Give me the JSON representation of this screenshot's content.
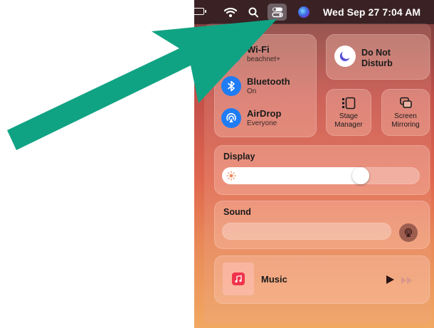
{
  "menubar": {
    "clock": "Wed Sep 27  7:04 AM",
    "icons": [
      "battery-icon",
      "wifi-icon",
      "search-icon",
      "control-center-icon",
      "siri-icon"
    ]
  },
  "control_center": {
    "network": {
      "wifi": {
        "title": "Wi-Fi",
        "subtitle": "beachnet+",
        "icon": "wifi-icon"
      },
      "bluetooth": {
        "title": "Bluetooth",
        "subtitle": "On",
        "icon": "bluetooth-icon"
      },
      "airdrop": {
        "title": "AirDrop",
        "subtitle": "Everyone",
        "icon": "airdrop-icon"
      }
    },
    "dnd": {
      "label": "Do Not Disturb",
      "icon": "moon-icon"
    },
    "stage_manager": {
      "label": "Stage Manager",
      "icon": "stage-manager-icon"
    },
    "screen_mirroring": {
      "label": "Screen Mirroring",
      "icon": "screen-mirroring-icon"
    },
    "display": {
      "title": "Display",
      "brightness": 0.72,
      "icon": "sun-icon"
    },
    "sound": {
      "title": "Sound",
      "volume": 0.0,
      "icon": "speaker-icon",
      "output_icon": "airplay-audio-icon"
    },
    "music": {
      "title": "Music",
      "icon": "music-note-icon",
      "play_icon": "play-icon",
      "forward_icon": "fast-forward-icon"
    }
  },
  "colors": {
    "accent_blue": "#1f7cf4",
    "annotation_arrow": "#10a383",
    "music_red": "#f0344c"
  }
}
